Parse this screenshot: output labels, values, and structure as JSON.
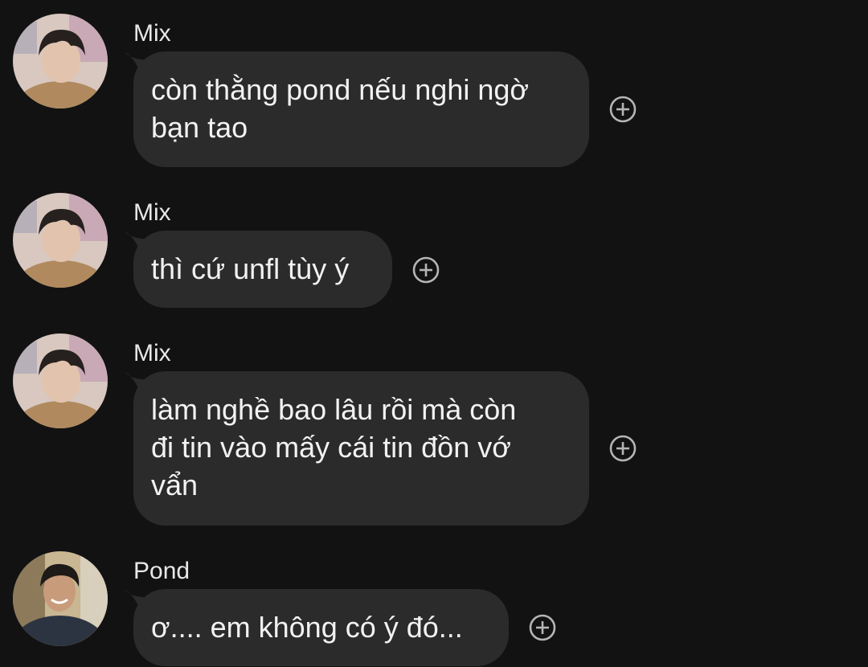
{
  "colors": {
    "background": "#121212",
    "bubble": "#2b2b2b",
    "text": "#f2f2f2",
    "icon": "#b5b5b5"
  },
  "messages": [
    {
      "sender": "Mix",
      "avatar": "mix-avatar",
      "text_lines": [
        "còn thằng pond nếu nghi ngờ",
        "bạn tao"
      ],
      "reaction_icon": "add-reaction-icon"
    },
    {
      "sender": "Mix",
      "avatar": "mix-avatar",
      "text_lines": [
        "thì cứ unfl tùy ý"
      ],
      "reaction_icon": "add-reaction-icon"
    },
    {
      "sender": "Mix",
      "avatar": "mix-avatar",
      "text_lines": [
        "làm nghề bao lâu rồi mà còn",
        "đi tin vào mấy cái tin đồn vớ",
        "vẩn"
      ],
      "reaction_icon": "add-reaction-icon"
    },
    {
      "sender": "Pond",
      "avatar": "pond-avatar",
      "text_lines": [
        "ơ.... em không có ý đó..."
      ],
      "reaction_icon": "add-reaction-icon"
    }
  ]
}
